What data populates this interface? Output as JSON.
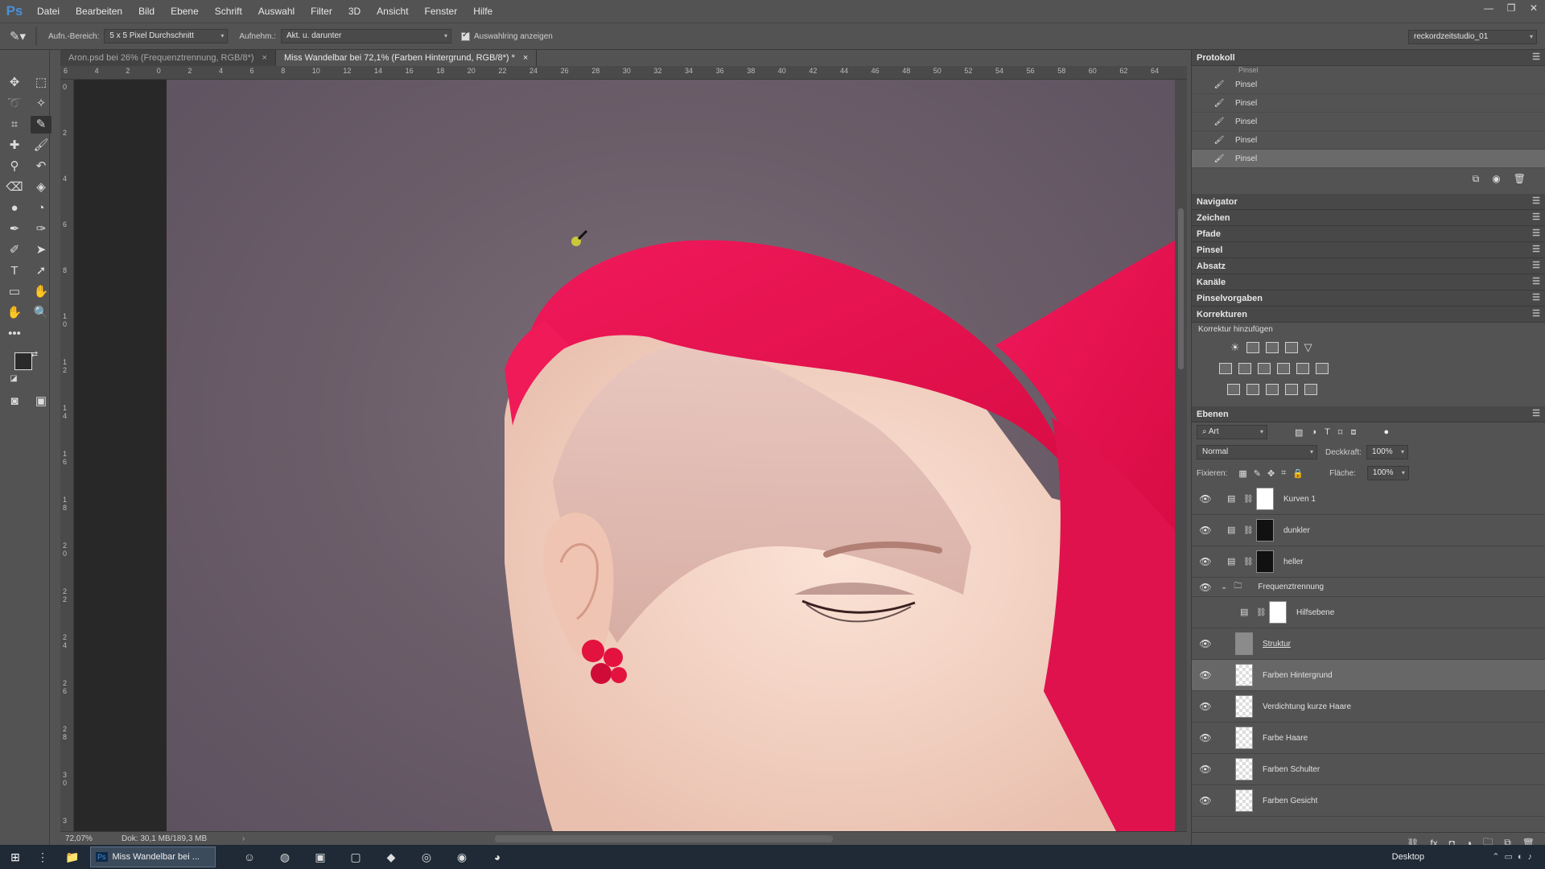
{
  "menubar": {
    "logo": "Ps",
    "items": [
      "Datei",
      "Bearbeiten",
      "Bild",
      "Ebene",
      "Schrift",
      "Auswahl",
      "Filter",
      "3D",
      "Ansicht",
      "Fenster",
      "Hilfe"
    ]
  },
  "options": {
    "sample_size_label": "Aufn.-Bereich:",
    "sample_size_value": "5 x 5 Pixel Durchschnitt",
    "sample_label": "Aufnehm.:",
    "sample_value": "Akt. u. darunter",
    "show_ring_label": "Auswahlring anzeigen",
    "workspace": "reckordzeitstudio_01"
  },
  "tabs": [
    {
      "label": "Aron.psd bei 26% (Frequenztrennung, RGB/8*)",
      "active": false
    },
    {
      "label": "Miss Wandelbar bei 72,1% (Farben Hintergrund, RGB/8*) *",
      "active": true
    }
  ],
  "ruler_top_ticks": [
    "6",
    "4",
    "2",
    "0",
    "2",
    "4",
    "6",
    "8",
    "10",
    "12",
    "14",
    "16",
    "18",
    "20",
    "22",
    "24",
    "26",
    "28",
    "30",
    "32",
    "34",
    "36",
    "38",
    "40",
    "42",
    "44",
    "46",
    "48",
    "50",
    "52",
    "54",
    "56",
    "58",
    "60",
    "62",
    "64"
  ],
  "ruler_left_ticks": [
    "0",
    "2",
    "4",
    "6",
    "8",
    "1 0",
    "1 2",
    "1 4",
    "1 6",
    "1 8",
    "2 0",
    "2 2",
    "2 4",
    "2 6",
    "2 8",
    "3 0",
    "3"
  ],
  "status": {
    "zoom": "72,07%",
    "doc": "Dok: 30,1 MB/189,3 MB"
  },
  "history": {
    "title": "Protokoll",
    "items": [
      {
        "label": "Pinsel",
        "current": false
      },
      {
        "label": "Pinsel",
        "current": false
      },
      {
        "label": "Pinsel",
        "current": false
      },
      {
        "label": "Pinsel",
        "current": false
      },
      {
        "label": "Pinsel",
        "current": true
      }
    ],
    "partial_top": "Pinsel"
  },
  "collapsed_panels": [
    "Navigator",
    "Zeichen",
    "Pfade",
    "Pinsel",
    "Absatz",
    "Kanäle",
    "Pinselvorgaben"
  ],
  "corrections": {
    "title": "Korrekturen",
    "subtitle": "Korrektur hinzufügen"
  },
  "layers_panel": {
    "title": "Ebenen",
    "filter_value": "Art",
    "blend_mode": "Normal",
    "opacity_label": "Deckkraft:",
    "opacity_value": "100%",
    "lock_label": "Fixieren:",
    "fill_label": "Fläche:",
    "fill_value": "100%",
    "layers": [
      {
        "name": "Kurven 1",
        "kind": "adjustment",
        "thumb": "white",
        "visible": true,
        "selected": false,
        "indent": 0
      },
      {
        "name": "dunkler",
        "kind": "adjustment",
        "thumb": "black",
        "visible": true,
        "selected": false,
        "indent": 0
      },
      {
        "name": "heller",
        "kind": "adjustment",
        "thumb": "black",
        "visible": true,
        "selected": false,
        "indent": 0
      },
      {
        "name": "Frequenztrennung",
        "kind": "group",
        "thumb": "",
        "visible": true,
        "selected": false,
        "indent": 0
      },
      {
        "name": "Hilfsebene",
        "kind": "adjustment",
        "thumb": "white",
        "visible": false,
        "selected": false,
        "indent": 1
      },
      {
        "name": "Struktur",
        "kind": "pixel",
        "thumb": "gray",
        "visible": true,
        "selected": false,
        "indent": 1
      },
      {
        "name": "Farben Hintergrund",
        "kind": "pixel",
        "thumb": "checker",
        "visible": true,
        "selected": true,
        "indent": 1
      },
      {
        "name": "Verdichtung kurze Haare",
        "kind": "pixel",
        "thumb": "checker",
        "visible": true,
        "selected": false,
        "indent": 1
      },
      {
        "name": "Farbe Haare",
        "kind": "pixel",
        "thumb": "checker",
        "visible": true,
        "selected": false,
        "indent": 1
      },
      {
        "name": "Farben Schulter",
        "kind": "pixel",
        "thumb": "checker",
        "visible": true,
        "selected": false,
        "indent": 1
      },
      {
        "name": "Farben Gesicht",
        "kind": "pixel",
        "thumb": "checker",
        "visible": true,
        "selected": false,
        "indent": 1
      }
    ]
  },
  "taskbar": {
    "active_app": "Miss Wandelbar bei ...",
    "desktop_label": "Desktop"
  },
  "colors": {
    "foreground": "#2a2a2a",
    "background": "#e8b9b1",
    "hair": "#e8124c",
    "skin": "#f0c9b8",
    "backdrop": "#6f6270"
  }
}
